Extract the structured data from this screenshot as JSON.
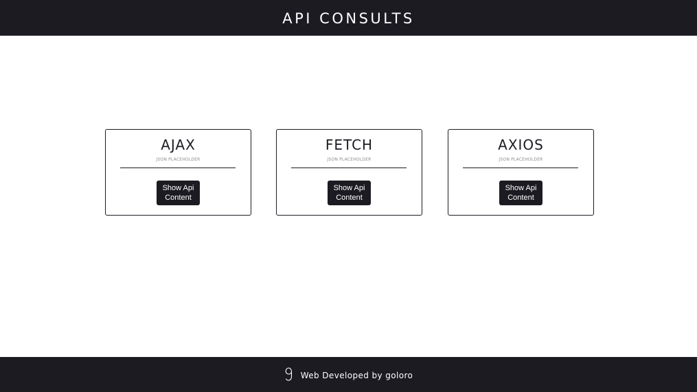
{
  "header": {
    "title": "API CONSULTS"
  },
  "cards": [
    {
      "title": "AJAX",
      "subtitle": "JSON PLACEHOLDER",
      "button_label": "Show Api Content"
    },
    {
      "title": "FETCH",
      "subtitle": "JSON PLACEHOLDER",
      "button_label": "Show Api Content"
    },
    {
      "title": "AXIOS",
      "subtitle": "JSON PLACEHOLDER",
      "button_label": "Show Api Content"
    }
  ],
  "footer": {
    "icon": "developer-logo-icon",
    "text": "Web Developed by goloro"
  },
  "colors": {
    "dark": "#1c1b22",
    "background": "#ffffff",
    "subtitle": "#8a8a8a"
  }
}
